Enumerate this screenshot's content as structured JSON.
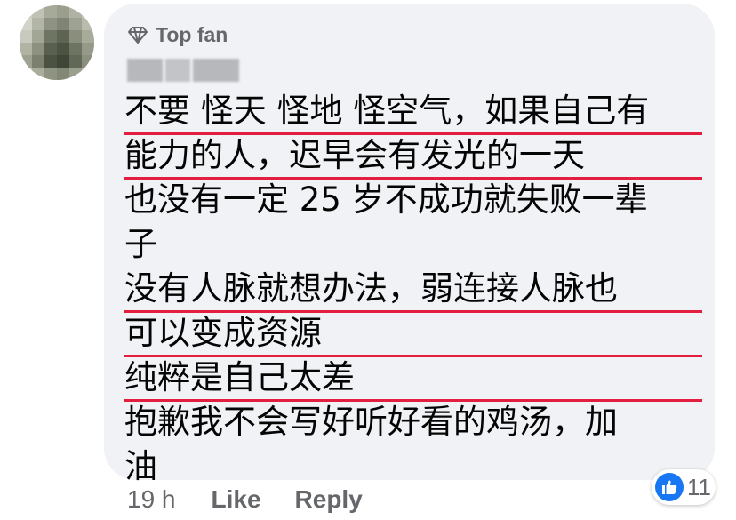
{
  "comment": {
    "badge_label": "Top fan",
    "lines": [
      {
        "text": "不要 怪天 怪地 怪空气，如果自己有",
        "underlined": true
      },
      {
        "text": "能力的人，迟早会有发光的一天",
        "underlined": true
      },
      {
        "text": "也没有一定 25 岁不成功就失败一辈",
        "underlined": false
      },
      {
        "text": "子",
        "underlined": false
      },
      {
        "text": "没有人脉就想办法，弱连接人脉也",
        "underlined": true
      },
      {
        "text": "可以变成资源",
        "underlined": true
      },
      {
        "text": "纯粹是自己太差",
        "underlined": true
      },
      {
        "text": "抱歉我不会写好听好看的鸡汤，加",
        "underlined": false
      },
      {
        "text": "油",
        "underlined": false
      }
    ],
    "underline_color": "#e41e3f"
  },
  "meta": {
    "time": "19 h",
    "like_label": "Like",
    "reply_label": "Reply"
  },
  "reactions": {
    "icon": "thumbs-up-icon",
    "count": "11",
    "color": "#1877f2"
  },
  "colors": {
    "bubble": "#f0f2f5",
    "secondary_text": "#65676b",
    "primary_text": "#050505"
  }
}
